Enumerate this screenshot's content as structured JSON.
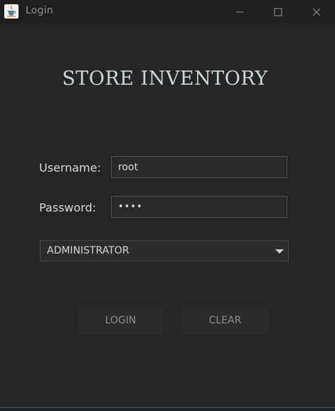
{
  "window": {
    "title": "Login",
    "icon": "java-cup-icon",
    "controls": [
      "minimize-icon",
      "maximize-icon",
      "close-icon"
    ]
  },
  "app": {
    "heading": "STORE INVENTORY"
  },
  "form": {
    "username_label": "Username:",
    "username_value": "root",
    "password_label": "Password:",
    "password_value": "••••",
    "role_selected": "ADMINISTRATOR"
  },
  "buttons": {
    "login": "LOGIN",
    "clear": "CLEAR"
  },
  "colors": {
    "background": "#252525",
    "titlebar": "#1f1f1f",
    "text": "#d9d9d9",
    "button_text": "#8e8e8e",
    "heading": "#ccd6db"
  }
}
